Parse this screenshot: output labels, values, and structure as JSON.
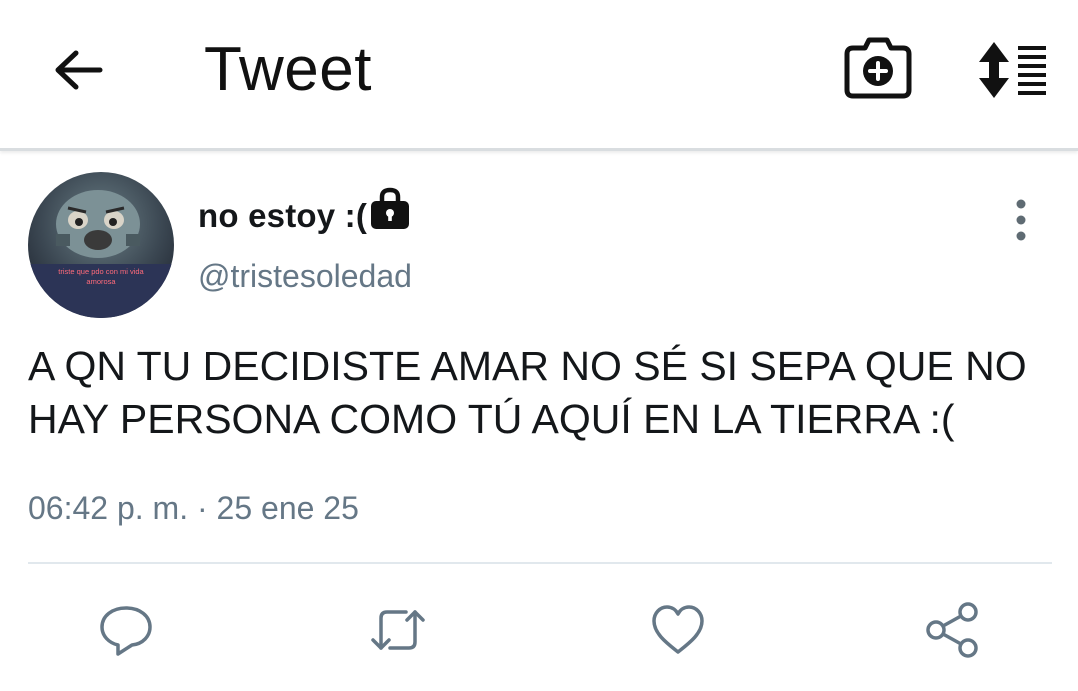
{
  "header": {
    "title": "Tweet",
    "back_icon": "arrow-left-icon",
    "camera_icon": "camera-plus-icon",
    "sort_icon": "sort-list-icon"
  },
  "tweet": {
    "display_name": "no estoy :(",
    "protected_icon": "lock-icon",
    "handle": "@tristesoledad",
    "avatar_caption": "triste que pdo con mi vida amorosa",
    "text": "A QN TU DECIDISTE AMAR NO SÉ SI SEPA QUE NO HAY PERSONA COMO TÚ AQUÍ EN LA TIERRA :(",
    "timestamp": "06:42 p. m. · 25 ene 25",
    "more_icon": "more-vertical-icon"
  },
  "actions": [
    {
      "name": "reply",
      "icon": "reply-icon"
    },
    {
      "name": "retweet",
      "icon": "retweet-icon"
    },
    {
      "name": "like",
      "icon": "heart-icon"
    },
    {
      "name": "share",
      "icon": "share-icon"
    }
  ],
  "colors": {
    "text_primary": "#14171a",
    "text_secondary": "#657786",
    "icon_action": "#657786",
    "divider": "#e1e8ed"
  }
}
